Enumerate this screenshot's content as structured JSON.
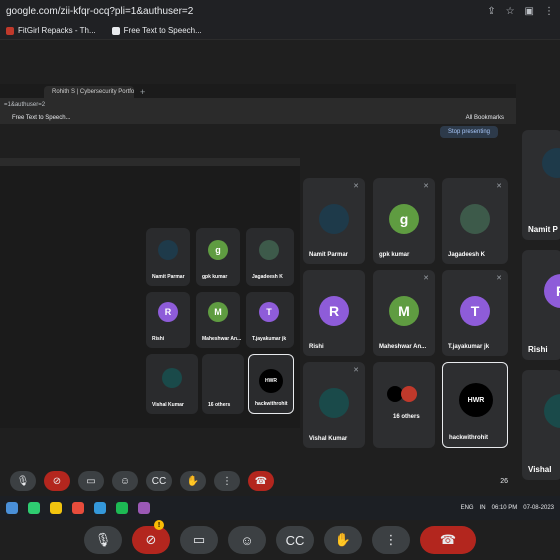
{
  "browser": {
    "url": "google.com/zii-kfqr-ocq?pli=1&authuser=2",
    "bookmarks": [
      {
        "label": "FitGirl Repacks - Th..."
      },
      {
        "label": "Free Text to Speech..."
      }
    ]
  },
  "presented_tab": {
    "tab_title": "Rohith S | Cybersecurity Portfolio",
    "url": "=1&authuser=2",
    "bookmark": "Free Text to Speech...",
    "all_bookmarks": "All Bookmarks",
    "stop_presenting": "Stop presenting"
  },
  "participants": {
    "namit": "Namit Parmar",
    "gpk": "gpk kumar",
    "jagadeesh": "Jagadeesh K",
    "rishi": "Rishi",
    "maheshwar": "Maheshwar An...",
    "tjaya": "T.jayakumar jk",
    "vishal": "Vishal Kumar",
    "others": "16 others",
    "hack": "hackwithrohit",
    "namit_cut": "Namit P",
    "rishi_cut": "Rishi",
    "vishal_cut": "Vishal"
  },
  "avatars": {
    "gpk": "g",
    "rishi": "R",
    "maheshwar": "M",
    "tjaya": "T",
    "rishi_cut": "R"
  },
  "nested": {
    "namit": "Namit Parmar",
    "gpk": "gpk kumar",
    "jagadeesh": "Jagadeesh K",
    "rishi": "Rishi",
    "maheshwar": "Maheshwar An...",
    "tjaya": "T.jayakumar jk",
    "vishal": "Vishal Kumar",
    "others": "16 others",
    "hack": "hackwithrohit",
    "stop_presenting": "Stop presenting",
    "all_bookmarks": "All Bookmarks"
  },
  "hack_logo": "HWR",
  "people_count": "26",
  "taskbar": {
    "lang": "ENG",
    "region": "IN",
    "time": "06:10 PM",
    "date": "07-08-2023"
  },
  "colors": {
    "avatar_green": "#5f9c41",
    "avatar_purple": "#8e5cd9",
    "end_call": "#b3261e"
  }
}
